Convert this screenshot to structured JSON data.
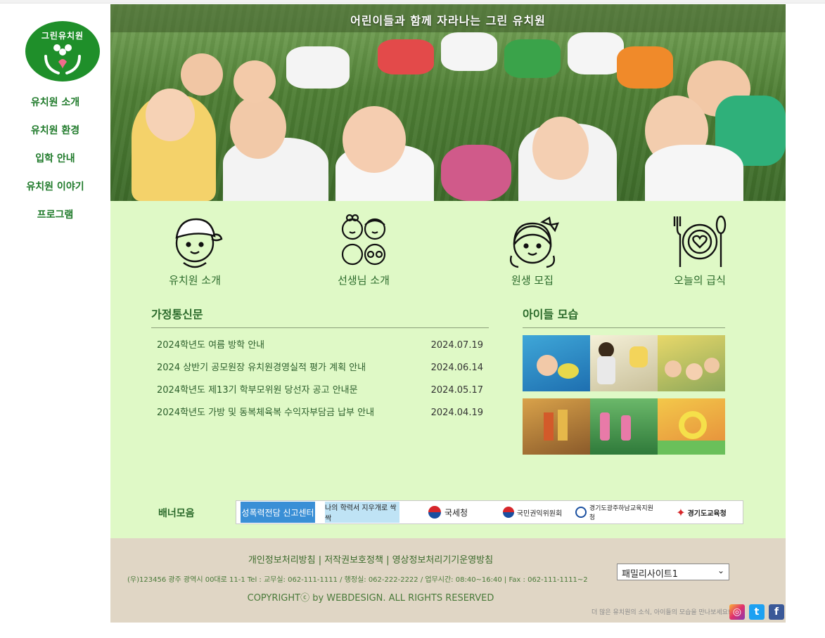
{
  "site": {
    "logo_text": "그린유치원",
    "hero_title": "어린이들과 함께 자라나는 그린 유치원"
  },
  "nav": {
    "items": [
      {
        "label": "유치원 소개"
      },
      {
        "label": "유치원 환경"
      },
      {
        "label": "입학 안내"
      },
      {
        "label": "유치원 이야기"
      },
      {
        "label": "프로그램"
      }
    ]
  },
  "quick_links": [
    {
      "label": "유치원 소개",
      "icon": "boy-cap-icon"
    },
    {
      "label": "선생님 소개",
      "icon": "four-kids-icon"
    },
    {
      "label": "원생 모집",
      "icon": "girl-ribbon-icon"
    },
    {
      "label": "오늘의 급식",
      "icon": "plate-utensils-icon"
    }
  ],
  "news": {
    "title": "가정통신문",
    "items": [
      {
        "title": "2024학년도 여름 방학 안내",
        "date": "2024.07.19"
      },
      {
        "title": "2024 상반기 공모원장 유치원경영실적 평가 계획 안내",
        "date": "2024.06.14"
      },
      {
        "title": "2024학년도 제13기 학부모위원 당선자 공고 안내문",
        "date": "2024.05.17"
      },
      {
        "title": "2024학년도 가방 및 동복체육복 수익자부담금 납부 안내",
        "date": "2024.04.19"
      }
    ]
  },
  "gallery": {
    "title": "아이들 모습"
  },
  "banners": {
    "label": "배너모음",
    "items": [
      {
        "text": "성폭력전담 신고센터"
      },
      {
        "text": "나의 학력서 지우개로 싹싹"
      },
      {
        "text": "국세청"
      },
      {
        "text": "국민권익위원회"
      },
      {
        "text": "경기도광주하남교육지원청"
      },
      {
        "text": "경기도교육청"
      }
    ]
  },
  "footer": {
    "links": "개인정보처리방침 | 저작권보호정책 | 영상정보처리기기운영방침",
    "address": "(우)123456 광주 광역시 00대로 11-1 Tel : 교무실: 062-111-1111 / 행정실: 062-222-2222 / 업무시간: 08:40~16:40 | Fax : 062-111-1111~2",
    "copyright": "COPYRIGHTⓒ by WEBDESIGN. ALL RIGHTS RESERVED",
    "family_select": "패밀리사이트1",
    "note": "더 많은 유치원의 소식, 아이들의 모습을 만나보세요!"
  },
  "colors": {
    "accent": "#1f8f2a",
    "main_bg": "#dff9c6",
    "footer_bg": "#e0d6c5"
  }
}
